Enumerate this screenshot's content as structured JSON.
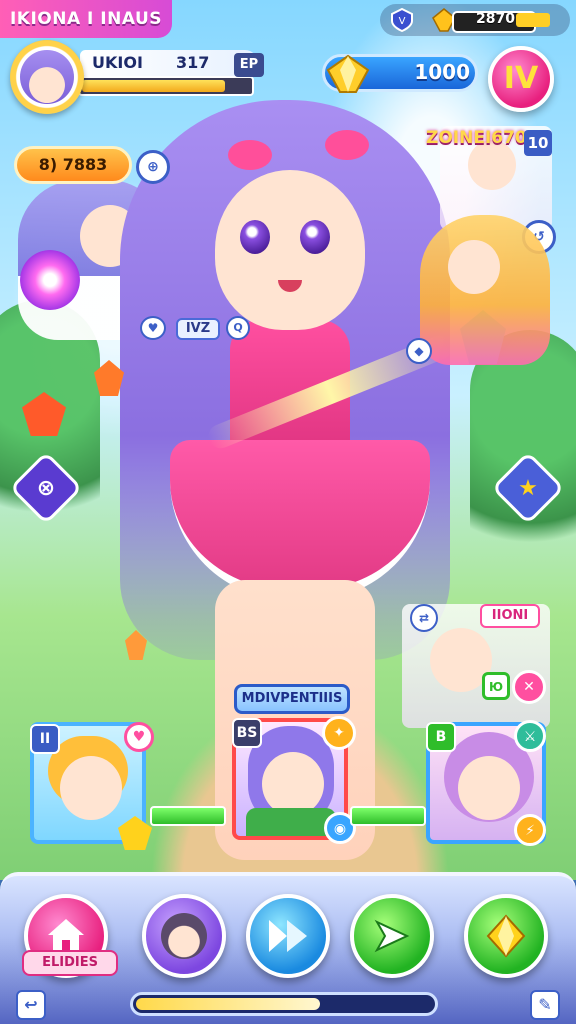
{
  "header": {
    "game_title": "IKIONA I INAUS",
    "status_text": "2870"
  },
  "player": {
    "name": "UKIOI",
    "level": "317",
    "exp_badge": "EP",
    "xp_fraction": 0.85
  },
  "currency": {
    "gems": "1000"
  },
  "menu": {
    "symbol": "IV"
  },
  "energy": {
    "value": "8) 7883"
  },
  "event": {
    "label": "ZOINEI670",
    "count": "10"
  },
  "tags": {
    "hero_tag": "IVZ",
    "bonus_label": "IIONI"
  },
  "roster": {
    "banner": "MDIVPENTIIIS",
    "cards": [
      {
        "corner_left": "II",
        "hp_fraction": 0.6
      },
      {
        "corner_left": "BS",
        "hp_fraction": 0.7
      },
      {
        "corner_left": "B",
        "hp_fraction": 0.7
      }
    ]
  },
  "bottom_nav": {
    "home_label": "ELIDIES",
    "progress_fraction": 0.62
  },
  "colors": {
    "accent_pink": "#e8207e",
    "accent_blue": "#1a66d9",
    "gold": "#ffcf26"
  }
}
